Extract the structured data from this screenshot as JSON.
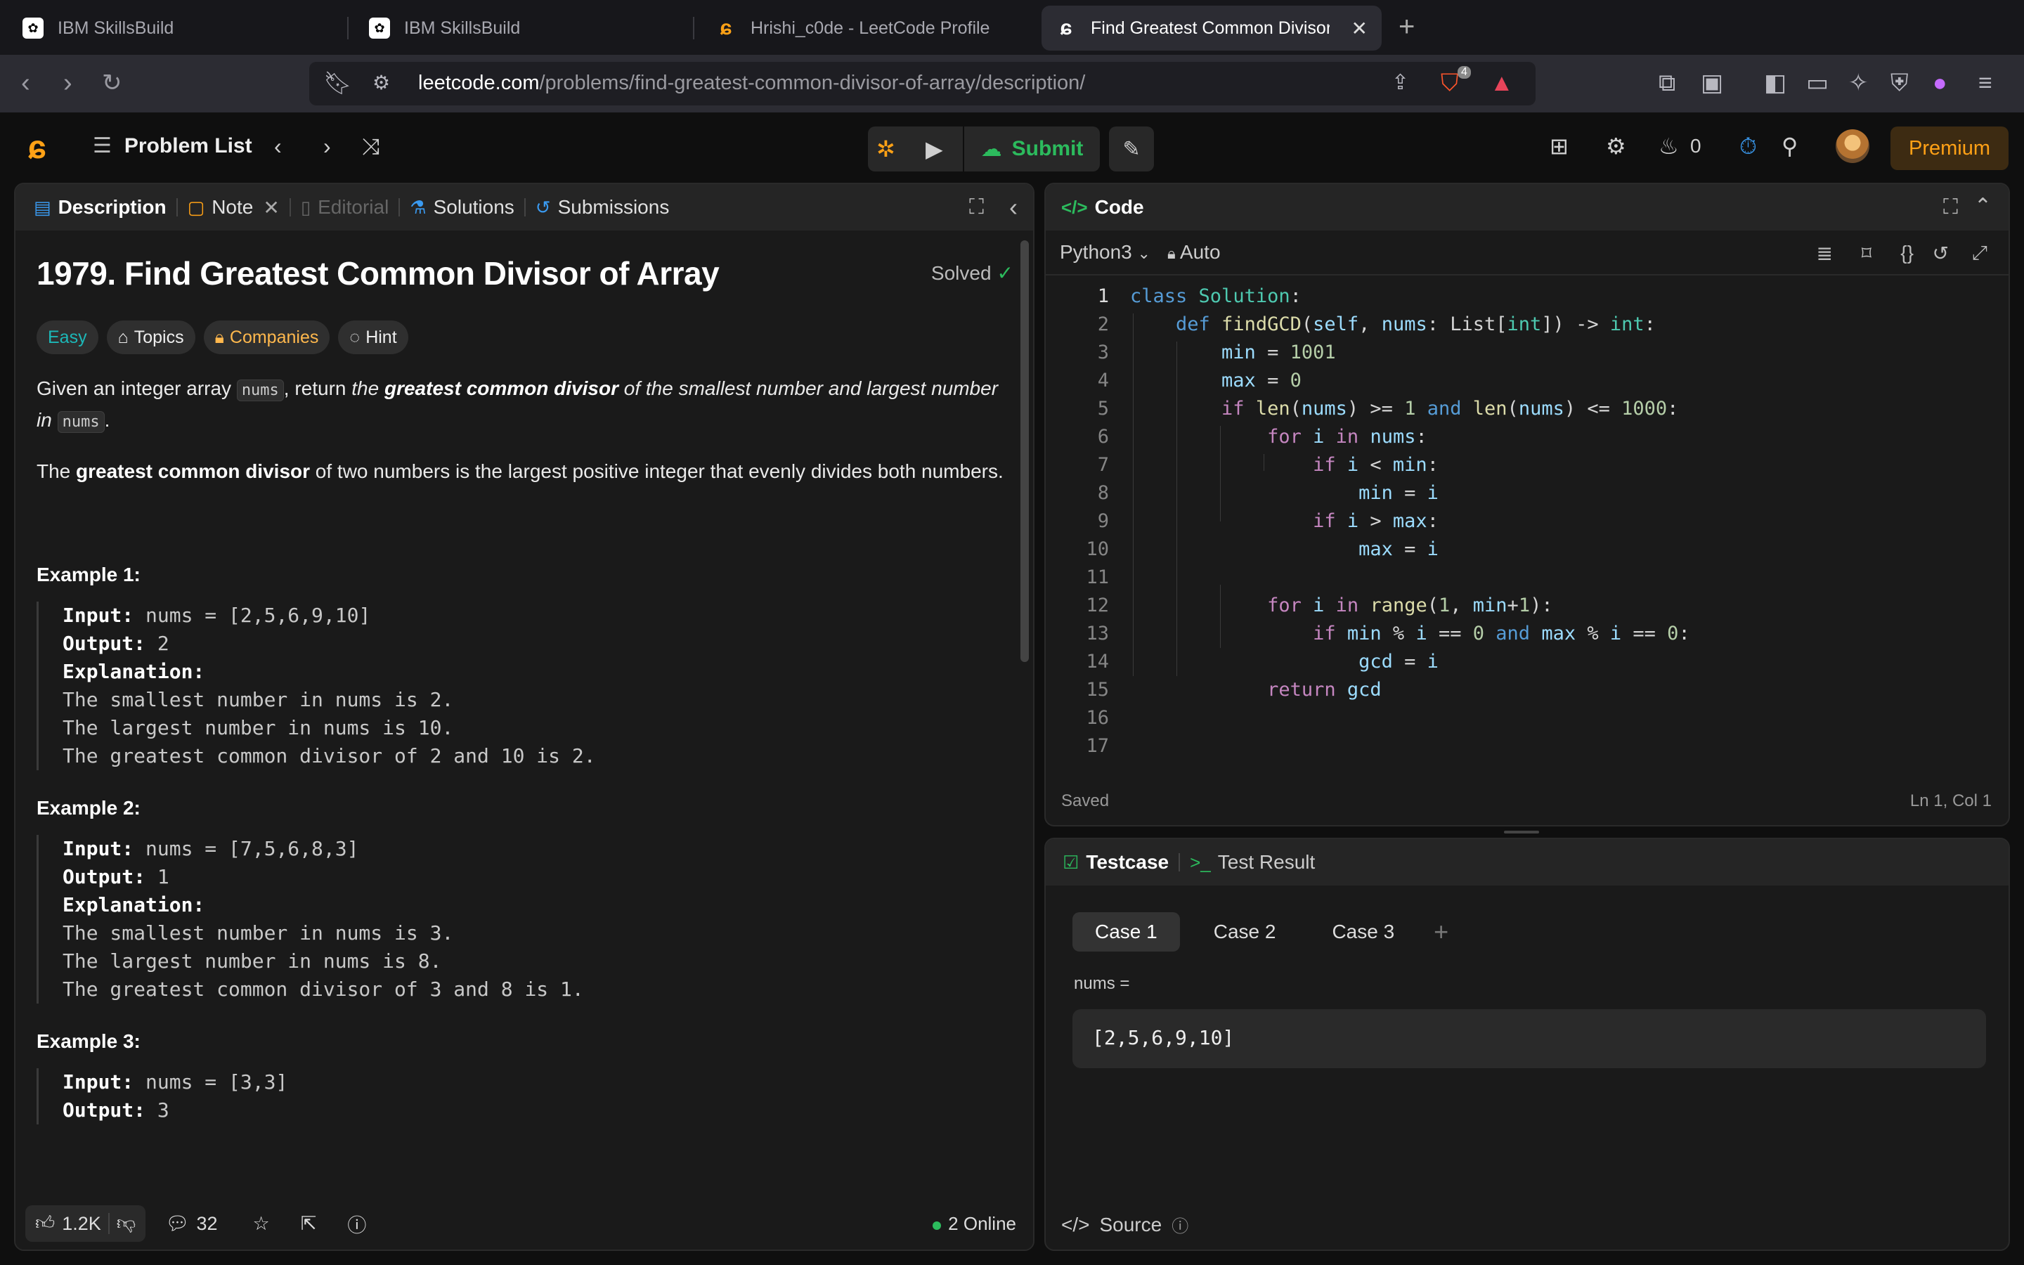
{
  "browser": {
    "tabs": [
      {
        "title": "IBM SkillsBuild"
      },
      {
        "title": "IBM SkillsBuild"
      },
      {
        "title": "Hrishi_c0de - LeetCode Profile"
      },
      {
        "title": "Find Greatest Common Divisor"
      }
    ],
    "url_host": "leetcode.com",
    "url_path": "/problems/find-greatest-common-divisor-of-array/description/",
    "shield_count": "4"
  },
  "topbar": {
    "problem_list": "Problem List",
    "submit": "Submit",
    "streak": "0",
    "premium": "Premium"
  },
  "description_panel": {
    "tabs": [
      "Description",
      "Note",
      "Editorial",
      "Solutions",
      "Submissions"
    ],
    "title": "1979. Find Greatest Common Divisor of Array",
    "status": "Solved",
    "chips": [
      "Easy",
      "Topics",
      "Companies",
      "Hint"
    ],
    "para1": {
      "a": "Given an integer array ",
      "code1": "nums",
      "b": ", return ",
      "c": "the ",
      "bold": "greatest common divisor",
      "d": " of the smallest number and largest number in ",
      "code2": "nums",
      "e": "."
    },
    "para2": {
      "a": "The ",
      "bold": "greatest common divisor",
      "b": " of two numbers is the largest positive integer that evenly divides both numbers."
    },
    "examples": [
      {
        "heading": "Example 1:",
        "input": "nums = [2,5,6,9,10]",
        "output": "2",
        "explanation": [
          "The smallest number in nums is 2.",
          "The largest number in nums is 10.",
          "The greatest common divisor of 2 and 10 is 2."
        ]
      },
      {
        "heading": "Example 2:",
        "input": "nums = [7,5,6,8,3]",
        "output": "1",
        "explanation": [
          "The smallest number in nums is 3.",
          "The largest number in nums is 8.",
          "The greatest common divisor of 3 and 8 is 1."
        ]
      },
      {
        "heading": "Example 3:",
        "input": "nums = [3,3]",
        "output": "3"
      }
    ],
    "labels": {
      "input": "Input:",
      "output": "Output:",
      "explanation": "Explanation:"
    },
    "footer": {
      "likes": "1.2K",
      "comments": "32",
      "online": "2 Online"
    }
  },
  "code_panel": {
    "title": "Code",
    "language": "Python3",
    "mode": "Auto",
    "status": "Saved",
    "cursor": "Ln 1, Col 1",
    "line_count": 17
  },
  "testcase_panel": {
    "tabs": [
      "Testcase",
      "Test Result"
    ],
    "cases": [
      "Case 1",
      "Case 2",
      "Case 3"
    ],
    "param_label": "nums =",
    "param_value": "[2,5,6,9,10]",
    "source": "Source"
  },
  "colors": {
    "accent": "#ffa116",
    "easy": "#1cb8b8",
    "submit": "#2cbb5d"
  }
}
